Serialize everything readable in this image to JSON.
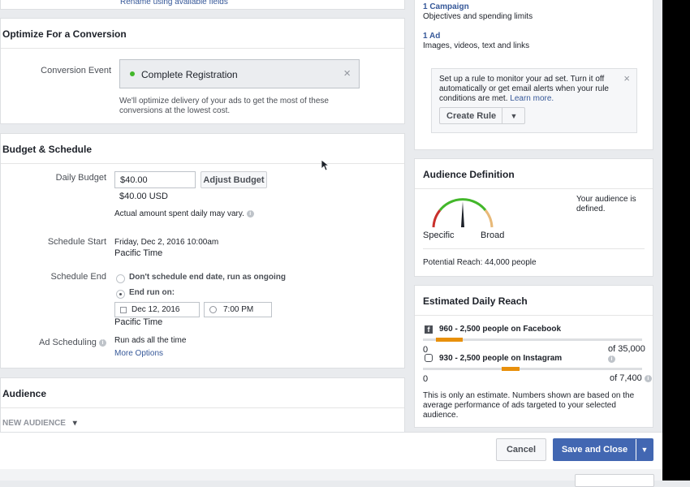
{
  "top": {
    "rename_link": "Rename using available fields"
  },
  "conversion": {
    "title": "Optimize For a Conversion",
    "event_label": "Conversion Event",
    "event_value": "Complete Registration",
    "help": "We'll optimize delivery of your ads to get the most of these conversions at the lowest cost."
  },
  "budget": {
    "title": "Budget & Schedule",
    "daily_label": "Daily Budget",
    "daily_value": "$40.00",
    "daily_sub": "$40.00 USD",
    "adjust_button": "Adjust Budget",
    "vary_note": "Actual amount spent daily may vary.",
    "start_label": "Schedule Start",
    "start_value": "Friday, Dec 2, 2016 10:00am",
    "start_tz": "Pacific Time",
    "end_label": "Schedule End",
    "end_option1": "Don't schedule end date, run as ongoing",
    "end_option2": "End run on:",
    "end_date": "Dec 12, 2016",
    "end_time": "7:00 PM",
    "end_tz": "Pacific Time",
    "scheduling_label": "Ad Scheduling",
    "scheduling_value": "Run ads all the time",
    "more_options": "More Options"
  },
  "audience": {
    "title": "Audience",
    "new_audience": "NEW AUDIENCE"
  },
  "summary": {
    "campaign_link": "1 Campaign",
    "campaign_desc": "Objectives and spending limits",
    "ad_link": "1 Ad",
    "ad_desc": "Images, videos, text and links",
    "rule_text": "Set up a rule to monitor your ad set. Turn it off automatically or get email alerts when your rule conditions are met.",
    "rule_link": "Learn more.",
    "create_rule": "Create Rule"
  },
  "audience_def": {
    "title": "Audience Definition",
    "status": "Your audience is defined.",
    "specific": "Specific",
    "broad": "Broad",
    "reach": "Potential Reach: 44,000 people",
    "gauge_level": 0.5
  },
  "daily_reach": {
    "title": "Estimated Daily Reach",
    "facebook": {
      "text": "960 - 2,500 people on Facebook",
      "min": "0",
      "max": "of 35,000",
      "range": [
        0.06,
        0.18
      ]
    },
    "instagram": {
      "text": "930 - 2,500 people on Instagram",
      "min": "0",
      "max": "of 7,400",
      "range": [
        0.36,
        0.44
      ]
    },
    "note": "This is only an estimate. Numbers shown are based on the average performance of ads targeted to your selected audience."
  },
  "footer": {
    "cancel": "Cancel",
    "save_close": "Save and Close"
  },
  "colors": {
    "primary": "#4267b2",
    "accent_orange": "#e8900c",
    "green": "#42b72a"
  }
}
